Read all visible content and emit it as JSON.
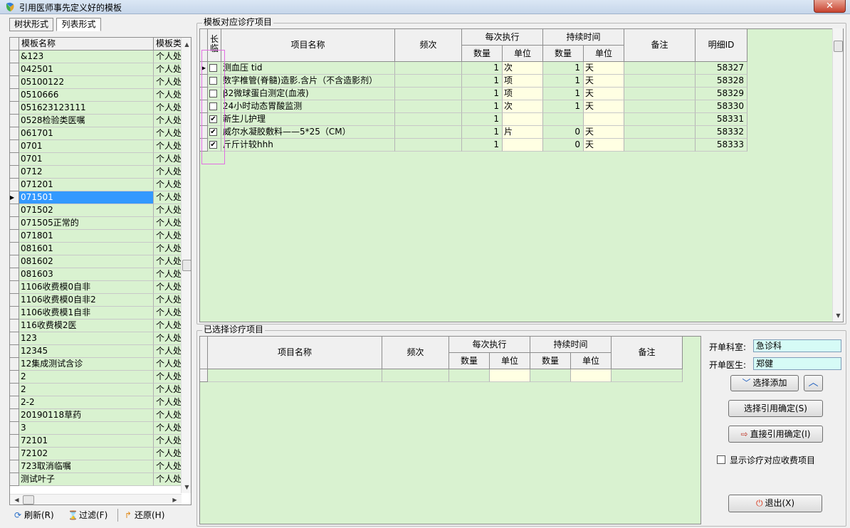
{
  "window": {
    "title": "引用医师事先定义好的模板",
    "close_label": "✕"
  },
  "left_tabs": [
    {
      "label": "树状形式"
    },
    {
      "label": "列表形式"
    }
  ],
  "template_list": {
    "columns": [
      "模板名称",
      "模板类别"
    ],
    "rows": [
      {
        "name": "&123",
        "type": "个人处方"
      },
      {
        "name": "042501",
        "type": "个人处方"
      },
      {
        "name": "05100122",
        "type": "个人处方"
      },
      {
        "name": "0510666",
        "type": "个人处方"
      },
      {
        "name": "051623123111",
        "type": "个人处方"
      },
      {
        "name": "0528检验类医嘱",
        "type": "个人处方"
      },
      {
        "name": "061701",
        "type": "个人处方"
      },
      {
        "name": "0701",
        "type": "个人处方"
      },
      {
        "name": "0701",
        "type": "个人处方"
      },
      {
        "name": "0712",
        "type": "个人处方"
      },
      {
        "name": "071201",
        "type": "个人处方"
      },
      {
        "name": "071501",
        "type": "个人处方",
        "selected": true
      },
      {
        "name": "071502",
        "type": "个人处方"
      },
      {
        "name": "071505正常的",
        "type": "个人处方"
      },
      {
        "name": "071801",
        "type": "个人处方"
      },
      {
        "name": "081601",
        "type": "个人处方"
      },
      {
        "name": "081602",
        "type": "个人处方"
      },
      {
        "name": "081603",
        "type": "个人处方"
      },
      {
        "name": "1106收费模0自非",
        "type": "个人处方"
      },
      {
        "name": "1106收费模0自非2",
        "type": "个人处方"
      },
      {
        "name": "1106收费模1自非",
        "type": "个人处方"
      },
      {
        "name": "116收费模2医",
        "type": "个人处方"
      },
      {
        "name": "123",
        "type": "个人处方"
      },
      {
        "name": "12345",
        "type": "个人处方"
      },
      {
        "name": "12集成测试含诊",
        "type": "个人处方"
      },
      {
        "name": "2",
        "type": "个人处方"
      },
      {
        "name": "2",
        "type": "个人处方"
      },
      {
        "name": "2-2",
        "type": "个人处方"
      },
      {
        "name": "20190118草药",
        "type": "个人处方"
      },
      {
        "name": "3",
        "type": "个人处方"
      },
      {
        "name": "72101",
        "type": "个人处方"
      },
      {
        "name": "72102",
        "type": "个人处方"
      },
      {
        "name": "723取消临嘱",
        "type": "个人处方"
      },
      {
        "name": "测试叶子",
        "type": "个人处方"
      }
    ]
  },
  "left_toolbar": [
    {
      "label": "刷新(R)",
      "icon": "refresh-icon"
    },
    {
      "label": "过滤(F)",
      "icon": "filter-icon"
    },
    {
      "label": "还原(H)",
      "icon": "restore-icon"
    }
  ],
  "template_items": {
    "group_label": "模板对应诊疗项目",
    "headers": {
      "long_term": "长临",
      "item_name": "项目名称",
      "frequency": "频次",
      "per_exec": "每次执行",
      "duration": "持续时间",
      "qty": "数量",
      "unit": "单位",
      "note": "备注",
      "detail_id": "明细ID"
    },
    "rows": [
      {
        "checked": false,
        "name": "测血压  tid",
        "freq": "",
        "qty": "1",
        "unit": "次",
        "dur_qty": "1",
        "dur_unit": "天",
        "note": "",
        "id": "58327",
        "current": true
      },
      {
        "checked": false,
        "name": "数字椎管(脊髓)造影.含片（不含造影剂）",
        "freq": "",
        "qty": "1",
        "unit": "项",
        "dur_qty": "1",
        "dur_unit": "天",
        "note": "",
        "id": "58328"
      },
      {
        "checked": false,
        "name": "β2微球蛋白测定(血液)",
        "freq": "",
        "qty": "1",
        "unit": "项",
        "dur_qty": "1",
        "dur_unit": "天",
        "note": "",
        "id": "58329"
      },
      {
        "checked": false,
        "name": "24小时动态胃酸监测",
        "freq": "",
        "qty": "1",
        "unit": "次",
        "dur_qty": "1",
        "dur_unit": "天",
        "note": "",
        "id": "58330"
      },
      {
        "checked": true,
        "name": "新生儿护理",
        "freq": "",
        "qty": "1",
        "unit": "",
        "dur_qty": "",
        "dur_unit": "",
        "note": "",
        "id": "58331"
      },
      {
        "checked": true,
        "name": "威尔水凝胶敷料——5*25（CM）",
        "freq": "",
        "qty": "1",
        "unit": "片",
        "dur_qty": "0",
        "dur_unit": "天",
        "note": "",
        "id": "58332"
      },
      {
        "checked": true,
        "name": "斤斤计较hhh",
        "freq": "",
        "qty": "1",
        "unit": "",
        "dur_qty": "0",
        "dur_unit": "天",
        "note": "",
        "id": "58333"
      }
    ]
  },
  "selected_items": {
    "group_label": "已选择诊疗项目",
    "headers": {
      "item_name": "项目名称",
      "frequency": "频次",
      "per_exec": "每次执行",
      "duration": "持续时间",
      "qty": "数量",
      "unit": "单位",
      "note": "备注"
    }
  },
  "order_info": {
    "dept_label": "开单科室:",
    "dept_value": "急诊科",
    "doctor_label": "开单医生:",
    "doctor_value": "郑健"
  },
  "buttons": {
    "select_add": "选择添加",
    "select_confirm": "选择引用确定(S)",
    "direct_confirm": "直接引用确定(I)",
    "show_fee_items": "显示诊疗对应收费项目",
    "exit": "退出(X)"
  }
}
